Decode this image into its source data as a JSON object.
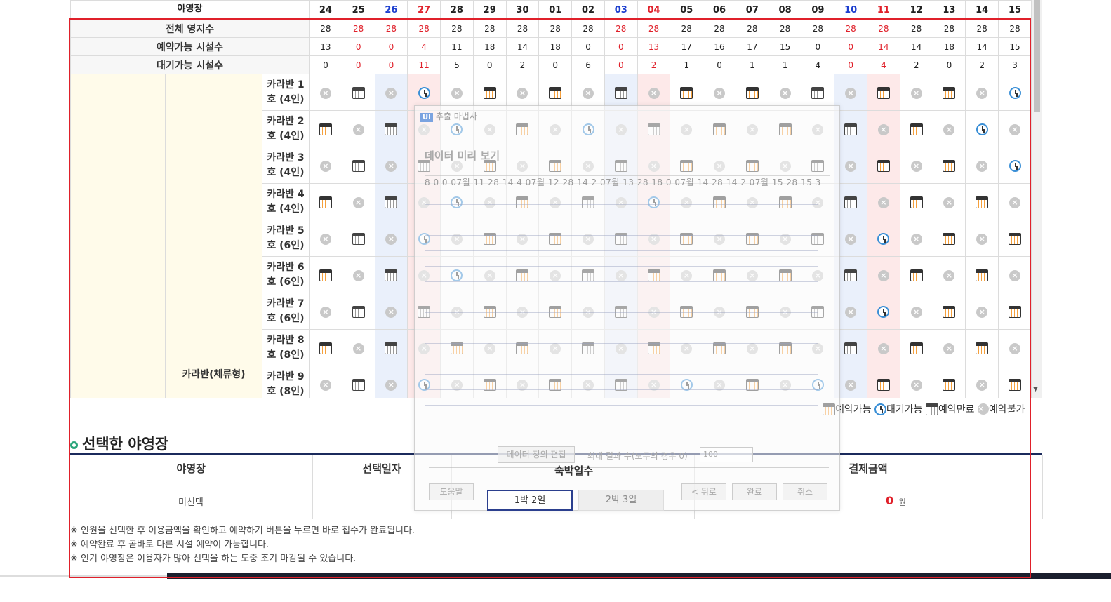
{
  "header_row": {
    "label": "야영장",
    "days": [
      "24",
      "25",
      "26",
      "27",
      "28",
      "29",
      "30",
      "01",
      "02",
      "03",
      "04",
      "05",
      "06",
      "07",
      "08",
      "09",
      "10",
      "11",
      "12",
      "13",
      "14",
      "15"
    ],
    "day_colors": [
      "",
      "",
      "blue",
      "red",
      "",
      "",
      "",
      "",
      "",
      "blue",
      "red",
      "",
      "",
      "",
      "",
      "",
      "blue",
      "red",
      "",
      "",
      "",
      ""
    ]
  },
  "stats": [
    {
      "label": "전체 영지수",
      "values": [
        "28",
        "28",
        "28",
        "28",
        "28",
        "28",
        "28",
        "28",
        "28",
        "28",
        "28",
        "28",
        "28",
        "28",
        "28",
        "28",
        "28",
        "28",
        "28",
        "28",
        "28",
        "28"
      ],
      "colors": [
        "",
        "red",
        "red",
        "red",
        "",
        "",
        "",
        "",
        "",
        "red",
        "red",
        "",
        "",
        "",
        "",
        "",
        "red",
        "red",
        "",
        "",
        "",
        ""
      ]
    },
    {
      "label": "예약가능 시설수",
      "values": [
        "13",
        "0",
        "0",
        "4",
        "11",
        "18",
        "14",
        "18",
        "0",
        "0",
        "13",
        "17",
        "16",
        "17",
        "15",
        "0",
        "0",
        "14",
        "14",
        "18",
        "14",
        "15"
      ],
      "colors": [
        "",
        "red",
        "red",
        "red",
        "",
        "",
        "",
        "",
        "",
        "red",
        "red",
        "",
        "",
        "",
        "",
        "",
        "red",
        "red",
        "",
        "",
        "",
        ""
      ]
    },
    {
      "label": "대기가능 시설수",
      "values": [
        "0",
        "0",
        "0",
        "11",
        "5",
        "0",
        "2",
        "0",
        "6",
        "0",
        "2",
        "1",
        "0",
        "1",
        "1",
        "4",
        "0",
        "4",
        "2",
        "0",
        "2",
        "3"
      ],
      "colors": [
        "",
        "red",
        "red",
        "red",
        "",
        "",
        "",
        "",
        "",
        "red",
        "red",
        "",
        "",
        "",
        "",
        "",
        "red",
        "red",
        "",
        "",
        "",
        ""
      ]
    }
  ],
  "category": "카라반(체류형)",
  "facilities": [
    {
      "name": "카라반 1\n호 (4인)",
      "cells": [
        "x",
        "cal",
        "x",
        "clock",
        "x",
        "calo",
        "x",
        "calo",
        "x",
        "cal",
        "x",
        "calo",
        "x",
        "calo",
        "x",
        "cal",
        "x",
        "calo",
        "x",
        "calo",
        "x",
        "clock"
      ]
    },
    {
      "name": "카라반 2\n호 (4인)",
      "cells": [
        "calo",
        "x",
        "cal",
        "x",
        "clock",
        "x",
        "calo",
        "x",
        "clock",
        "x",
        "cal",
        "x",
        "calo",
        "x",
        "calo",
        "x",
        "cal",
        "x",
        "calo",
        "x",
        "clock",
        "x"
      ]
    },
    {
      "name": "카라반 3\n호 (4인)",
      "cells": [
        "x",
        "cal",
        "x",
        "cal",
        "x",
        "calo",
        "x",
        "calo",
        "x",
        "cal",
        "x",
        "calo",
        "x",
        "calo",
        "x",
        "cal",
        "x",
        "calo",
        "x",
        "calo",
        "x",
        "clock"
      ]
    },
    {
      "name": "카라반 4\n호 (4인)",
      "cells": [
        "calo",
        "x",
        "cal",
        "x",
        "clock",
        "x",
        "calo",
        "x",
        "cal",
        "x",
        "clock",
        "x",
        "calo",
        "x",
        "calo",
        "x",
        "cal",
        "x",
        "calo",
        "x",
        "calo",
        "x"
      ]
    },
    {
      "name": "카라반 5\n호 (6인)",
      "cells": [
        "x",
        "cal",
        "x",
        "clock",
        "x",
        "calo",
        "x",
        "calo",
        "x",
        "cal",
        "x",
        "calo",
        "x",
        "calo",
        "x",
        "cal",
        "x",
        "clock",
        "x",
        "calo",
        "x",
        "calo"
      ]
    },
    {
      "name": "카라반 6\n호 (6인)",
      "cells": [
        "calo",
        "x",
        "cal",
        "x",
        "clock",
        "x",
        "calo",
        "x",
        "cal",
        "x",
        "calo",
        "x",
        "calo",
        "x",
        "calo",
        "x",
        "cal",
        "x",
        "calo",
        "x",
        "calo",
        "x"
      ]
    },
    {
      "name": "카라반 7\n호 (6인)",
      "cells": [
        "x",
        "cal",
        "x",
        "cal",
        "x",
        "calo",
        "x",
        "calo",
        "x",
        "cal",
        "x",
        "calo",
        "x",
        "calo",
        "x",
        "cal",
        "x",
        "clock",
        "x",
        "calo",
        "x",
        "calo"
      ]
    },
    {
      "name": "카라반 8\n호 (8인)",
      "cells": [
        "calo",
        "x",
        "cal",
        "x",
        "calo",
        "x",
        "calo",
        "x",
        "cal",
        "x",
        "calo",
        "x",
        "calo",
        "x",
        "calo",
        "x",
        "cal",
        "x",
        "calo",
        "x",
        "calo",
        "x"
      ]
    },
    {
      "name": "카라반 9\n호 (8인)",
      "cells": [
        "x",
        "cal",
        "x",
        "clock",
        "x",
        "calo",
        "x",
        "calo",
        "x",
        "cal",
        "x",
        "clock",
        "x",
        "calo",
        "x",
        "clock",
        "x",
        "calo",
        "x",
        "calo",
        "x",
        "calo"
      ]
    }
  ],
  "legend": {
    "available": "예약가능",
    "waiting": "대기가능",
    "booked": "예약만료",
    "unavailable": "예약불가"
  },
  "selected": {
    "title": "선택한 야영장",
    "headers": [
      "야영장",
      "선택일자",
      "숙박일수",
      "결제금액"
    ],
    "campsite": "미선택",
    "nights_options": [
      "1박 2일",
      "2박 3일"
    ],
    "price": "0",
    "currency": "원"
  },
  "notes": [
    "※ 인원을 선택한 후 이용금액을 확인하고 예약하기 버튼을 누르면 바로 접수가 완료됩니다.",
    "※ 예약완료 후 곧바로 다른 시설 예약이 가능합니다.",
    "※ 인기 야영장은 이용자가 많아 선택을 하는 도중 조기 마감될 수 있습니다."
  ],
  "wizard": {
    "title": "추출 마법사",
    "badge": "UI",
    "subtitle": "데이터 미리 보기",
    "preview_header": "8 0 0    07월 11 28 14 4    07월 12 28 14 2    07월 13 28 18 0    07월 14 28 14 2    07월 15 28 15 3",
    "edit_button": "데이터 정의 편집",
    "max_label": "최대 결과 수(모두의 경우 0)",
    "max_value": "100",
    "help_button": "도움말",
    "back_button": "< 뒤로",
    "finish_button": "완료",
    "cancel_button": "취소"
  }
}
